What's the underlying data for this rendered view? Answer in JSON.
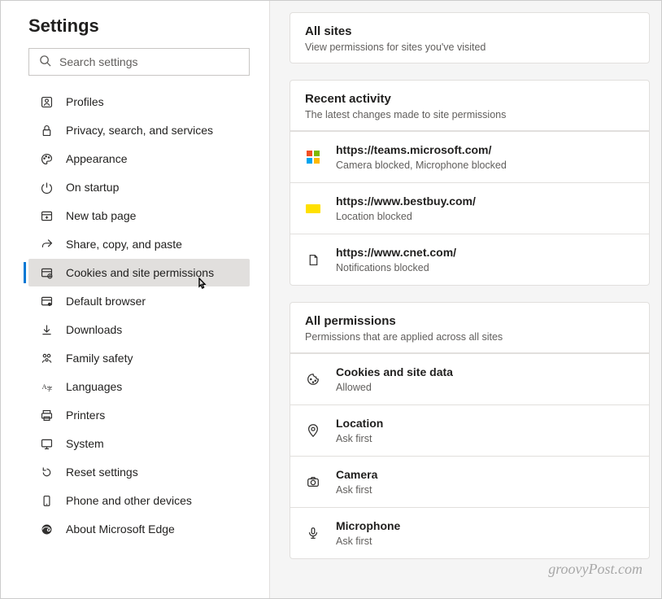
{
  "sidebar": {
    "title": "Settings",
    "search_placeholder": "Search settings",
    "items": [
      {
        "icon": "profile-icon",
        "label": "Profiles"
      },
      {
        "icon": "lock-icon",
        "label": "Privacy, search, and services"
      },
      {
        "icon": "appearance-icon",
        "label": "Appearance"
      },
      {
        "icon": "power-icon",
        "label": "On startup"
      },
      {
        "icon": "newtab-icon",
        "label": "New tab page"
      },
      {
        "icon": "share-icon",
        "label": "Share, copy, and paste"
      },
      {
        "icon": "cookies-icon",
        "label": "Cookies and site permissions"
      },
      {
        "icon": "browser-icon",
        "label": "Default browser"
      },
      {
        "icon": "download-icon",
        "label": "Downloads"
      },
      {
        "icon": "family-icon",
        "label": "Family safety"
      },
      {
        "icon": "language-icon",
        "label": "Languages"
      },
      {
        "icon": "printer-icon",
        "label": "Printers"
      },
      {
        "icon": "system-icon",
        "label": "System"
      },
      {
        "icon": "reset-icon",
        "label": "Reset settings"
      },
      {
        "icon": "phone-icon",
        "label": "Phone and other devices"
      },
      {
        "icon": "edge-icon",
        "label": "About Microsoft Edge"
      }
    ],
    "active_index": 6
  },
  "main": {
    "all_sites": {
      "title": "All sites",
      "subtitle": "View permissions for sites you've visited"
    },
    "recent": {
      "title": "Recent activity",
      "subtitle": "The latest changes made to site permissions",
      "items": [
        {
          "icon": "microsoft",
          "url": "https://teams.microsoft.com/",
          "detail": "Camera blocked, Microphone blocked"
        },
        {
          "icon": "bestbuy",
          "url": "https://www.bestbuy.com/",
          "detail": "Location blocked"
        },
        {
          "icon": "file",
          "url": "https://www.cnet.com/",
          "detail": "Notifications blocked"
        }
      ]
    },
    "all_perms": {
      "title": "All permissions",
      "subtitle": "Permissions that are applied across all sites",
      "items": [
        {
          "icon": "cookie-icon",
          "title": "Cookies and site data",
          "status": "Allowed"
        },
        {
          "icon": "location-icon",
          "title": "Location",
          "status": "Ask first"
        },
        {
          "icon": "camera-icon",
          "title": "Camera",
          "status": "Ask first"
        },
        {
          "icon": "microphone-icon",
          "title": "Microphone",
          "status": "Ask first"
        }
      ]
    }
  },
  "watermark": "groovyPost.com"
}
